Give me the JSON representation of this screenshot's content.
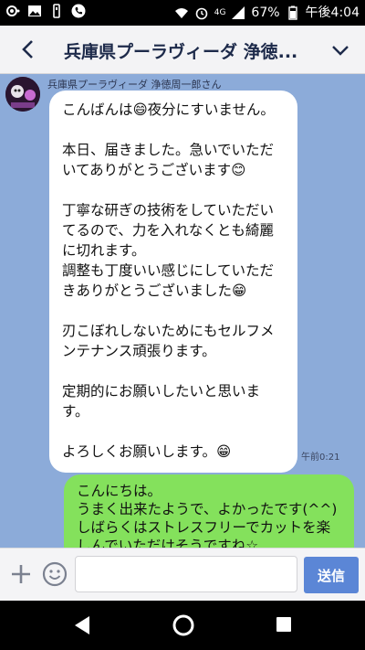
{
  "statusbar": {
    "battery": "67%",
    "network": "4G",
    "time": "午後4:04",
    "icons": [
      "record-icon",
      "image-icon",
      "usb-icon",
      "phone-icon",
      "wifi-icon",
      "alarm-icon",
      "signal-icon",
      "battery-icon"
    ]
  },
  "header": {
    "title": "兵庫県プーラヴィーダ 浄徳..."
  },
  "chat": {
    "incoming": {
      "sender": "兵庫県プーラヴィーダ 浄徳周一郎さん",
      "text": "こんばんは😄夜分にすいません。\n\n本日、届きました。急いでいただいてありがとうございます😊\n\n丁寧な研ぎの技術をしていただいてるので、力を入れなくとも綺麗に切れます。\n調整も丁度いい感じにしていただきありがとうございました😁\n\n刃こぼれしないためにもセルフメンテナンス頑張ります。\n\n定期的にお願いしたいと思います。\n\nよろしくお願いします。😁",
      "time": "午前0:21"
    },
    "outgoing": {
      "text": "こんにちは。\nうまく出来たようで、よかったです(^^)\nしばらくはストレスフリーでカットを楽しんでいただけそうですね☆"
    }
  },
  "input": {
    "placeholder": "",
    "send_label": "送信"
  },
  "colors": {
    "chat_bg": "#8cabd9",
    "outgoing_bubble": "#84e15c",
    "send_button": "#5b86d6"
  }
}
